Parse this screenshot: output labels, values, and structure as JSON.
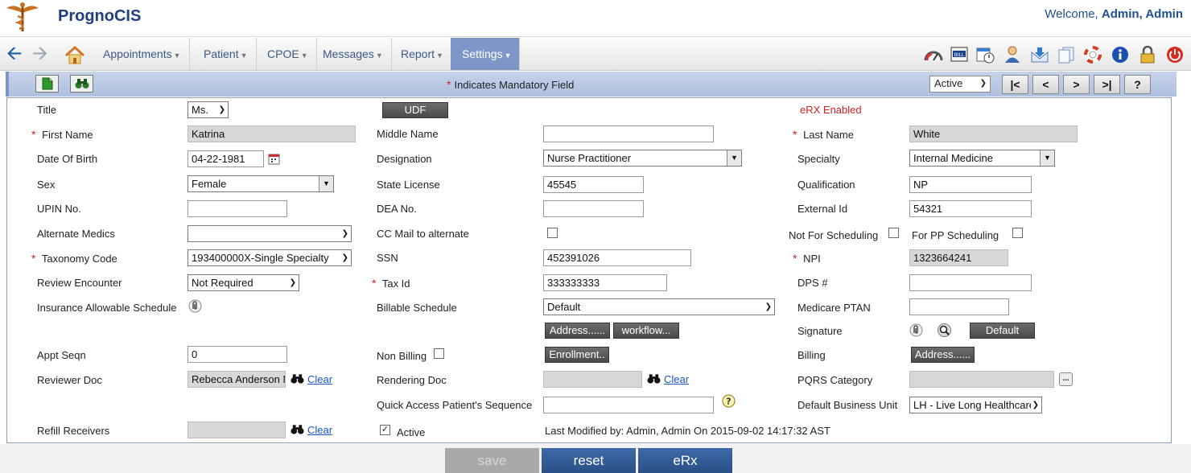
{
  "header": {
    "brand": "PrognoCIS",
    "welcome_prefix": "Welcome,",
    "user": "Admin, Admin"
  },
  "nav": {
    "menus": [
      {
        "label": "Appointments"
      },
      {
        "label": "Patient"
      },
      {
        "label": "CPOE"
      },
      {
        "label": "Messages"
      },
      {
        "label": "Report"
      },
      {
        "label": "Settings"
      }
    ],
    "active_menu": "Settings"
  },
  "toolbar": {
    "mandatory_note": "Indicates Mandatory Field",
    "status_value": "Active",
    "first": "|<",
    "prev": "<",
    "next": ">",
    "last": ">|",
    "help": "?"
  },
  "form": {
    "title_label": "Title",
    "title_value": "Ms.",
    "udf_button": "UDF",
    "erx_enabled": "eRX Enabled",
    "first_name_label": "First Name",
    "first_name_value": "Katrina",
    "middle_name_label": "Middle Name",
    "middle_name_value": "",
    "last_name_label": "Last Name",
    "last_name_value": "White",
    "dob_label": "Date Of Birth",
    "dob_value": "04-22-1981",
    "designation_label": "Designation",
    "designation_value": "Nurse Practitioner",
    "specialty_label": "Specialty",
    "specialty_value": "Internal Medicine",
    "sex_label": "Sex",
    "sex_value": "Female",
    "state_license_label": "State License",
    "state_license_value": "45545",
    "qualification_label": "Qualification",
    "qualification_value": "NP",
    "upin_label": "UPIN No.",
    "upin_value": "",
    "dea_label": "DEA No.",
    "dea_value": "",
    "external_id_label": "External Id",
    "external_id_value": "54321",
    "alt_medics_label": "Alternate Medics",
    "alt_medics_value": "",
    "cc_mail_label": "CC Mail to alternate",
    "not_for_sched_label": "Not For Scheduling",
    "for_pp_sched_label": "For PP Scheduling",
    "taxonomy_label": "Taxonomy Code",
    "taxonomy_value": "193400000X-Single Specialty",
    "ssn_label": "SSN",
    "ssn_value": "452391026",
    "npi_label": "NPI",
    "npi_value": "1323664241",
    "review_enc_label": "Review Encounter",
    "review_enc_value": "Not Required",
    "tax_id_label": "Tax Id",
    "tax_id_value": "333333333",
    "dps_label": "DPS #",
    "dps_value": "",
    "ins_allow_label": "Insurance Allowable Schedule",
    "billable_label": "Billable Schedule",
    "billable_value": "Default",
    "medicare_label": "Medicare PTAN",
    "medicare_value": "",
    "address_btn": "Address......",
    "workflow_btn": "workflow...",
    "signature_label": "Signature",
    "default_btn": "Default",
    "appt_seqn_label": "Appt Seqn",
    "appt_seqn_value": "0",
    "non_billing_label": "Non Billing",
    "enrollment_btn": "Enrollment..",
    "billing_label": "Billing",
    "billing_address_btn": "Address......",
    "reviewer_doc_label": "Reviewer Doc",
    "reviewer_doc_value": "Rebecca Anderson M",
    "clear_label": "Clear",
    "rendering_doc_label": "Rendering Doc",
    "rendering_doc_value": "",
    "pqrs_label": "PQRS Category",
    "pqrs_value": "",
    "quick_access_label": "Quick Access Patient's Sequence",
    "quick_access_value": "",
    "default_bu_label": "Default Business Unit",
    "default_bu_value": "LH - Live Long Healthcare",
    "refill_label": "Refill Receivers",
    "refill_value": "",
    "active_label": "Active",
    "last_modified": "Last Modified by: Admin, Admin On 2015-09-02 14:17:32 AST"
  },
  "actions": {
    "save": "save",
    "reset": "reset",
    "erx": "eRx"
  },
  "colors": {
    "brand": "#1f3f7f",
    "active_menu": "#7e96c8",
    "toolbar_bar": "#b7c7e6",
    "mandatory": "#cc2222",
    "action_button": "#34609c"
  }
}
